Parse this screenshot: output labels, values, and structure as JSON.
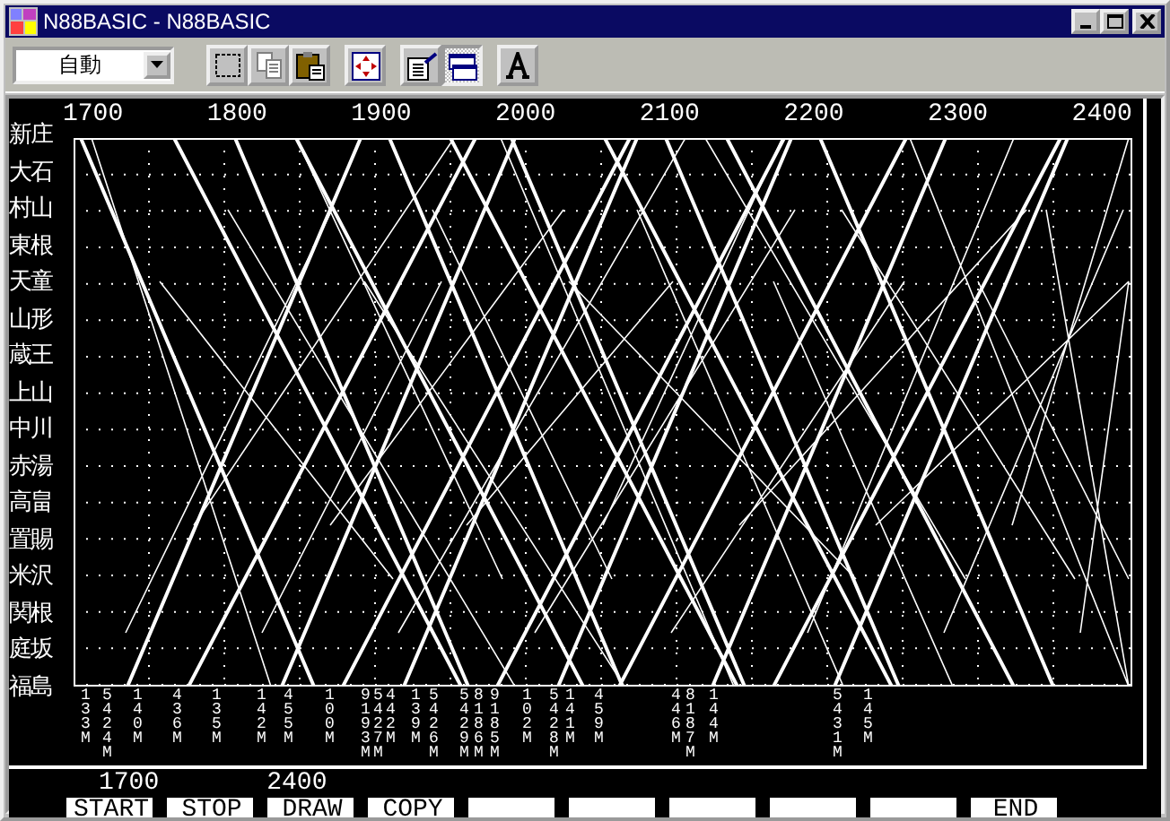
{
  "window": {
    "title": "N88BASIC - N88BASIC"
  },
  "toolbar": {
    "mode_select": {
      "value": "自動"
    },
    "buttons": [
      {
        "kind": "select",
        "pressed": false
      },
      {
        "kind": "copy",
        "pressed": false
      },
      {
        "kind": "paste",
        "pressed": false
      },
      {
        "kind": "fullscreen",
        "pressed": false
      },
      {
        "kind": "properties",
        "pressed": false
      },
      {
        "kind": "background",
        "pressed": true
      },
      {
        "kind": "font",
        "pressed": false
      }
    ]
  },
  "time_axis": [
    "1700",
    "1800",
    "1900",
    "2000",
    "2100",
    "2200",
    "2300",
    "2400"
  ],
  "stations": [
    "新庄",
    "大石",
    "村山",
    "東根",
    "天童",
    "山形",
    "蔵王",
    "上山",
    "中川",
    "赤湯",
    "高畠",
    "置賜",
    "米沢",
    "関根",
    "庭坂",
    "福島"
  ],
  "train_numbers": [
    "133M",
    "5424M",
    "140M",
    "436M",
    "135M",
    "142M",
    "455M",
    "100M",
    "9193M",
    "5427M",
    "442M",
    "139M",
    "5426M",
    "5429M",
    "8186M",
    "9185M",
    "102M",
    "5428M",
    "141M",
    "459M",
    "446M",
    "8187M",
    "144M",
    "5431M",
    "145M"
  ],
  "range": {
    "start": "1700",
    "end": "2400"
  },
  "function_keys": [
    {
      "kind": "label",
      "label": "START"
    },
    {
      "kind": "label",
      "label": "STOP"
    },
    {
      "kind": "label",
      "label": "DRAW"
    },
    {
      "kind": "label",
      "label": "COPY"
    },
    {
      "kind": "blank"
    },
    {
      "kind": "blank"
    },
    {
      "kind": "blank"
    },
    {
      "kind": "blank"
    },
    {
      "kind": "blank"
    },
    {
      "kind": "label",
      "label": "END"
    }
  ]
}
